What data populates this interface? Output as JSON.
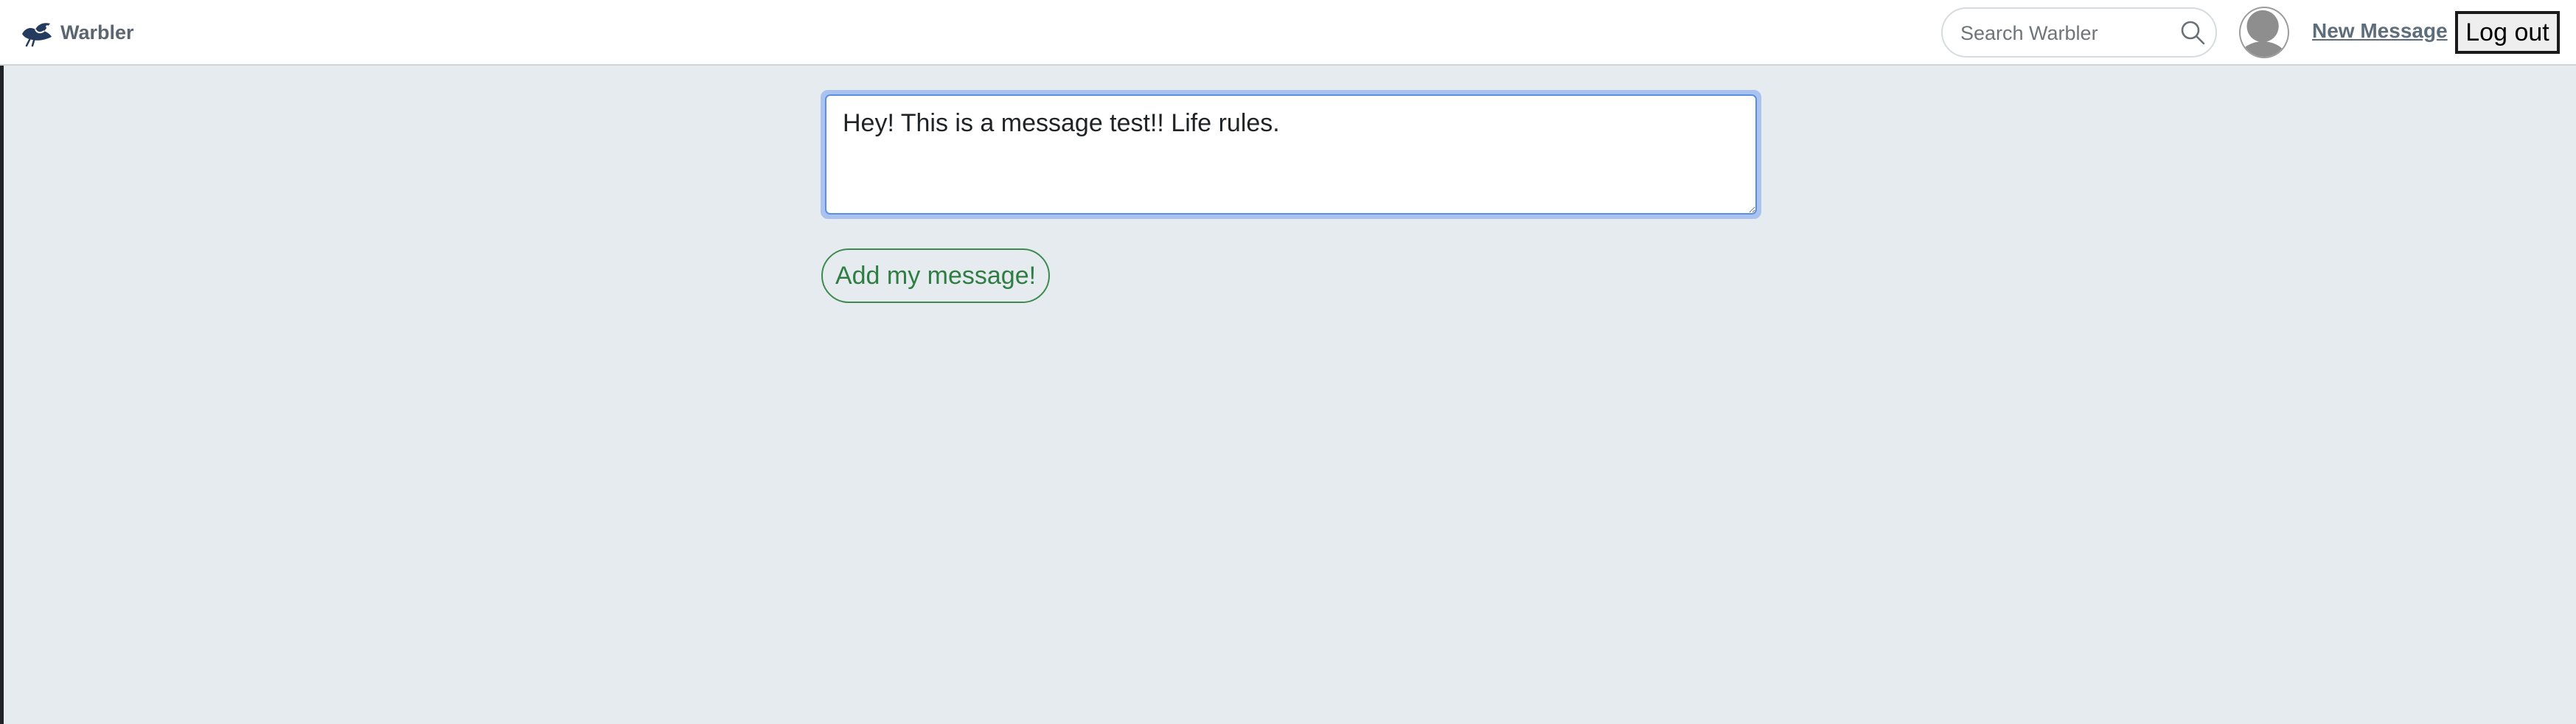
{
  "navbar": {
    "brand_name": "Warbler",
    "search": {
      "placeholder": "Search Warbler",
      "value": ""
    },
    "new_message_label": "New Message",
    "logout_label": "Log out"
  },
  "form": {
    "message_value": "Hey! This is a message test!! Life rules.",
    "submit_label": "Add my message!"
  },
  "colors": {
    "background": "#e6ebef",
    "submit_green": "#2e7d43",
    "focus_blue": "#a9c2f0",
    "nav_link": "#5d6d7b"
  },
  "icons": {
    "brand": "bird-logo-icon",
    "search": "search-icon",
    "avatar": "default-avatar-icon"
  }
}
